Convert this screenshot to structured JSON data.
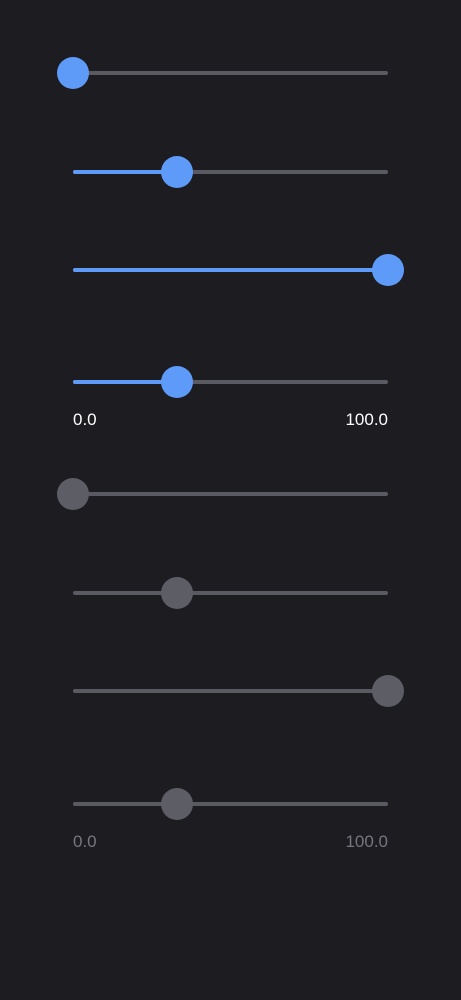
{
  "colors": {
    "background": "#1c1c21",
    "active_fill": "#5e9bf8",
    "active_thumb": "#5e9bf8",
    "inactive_track": "#5a5a62",
    "disabled_thumb": "#5d5d66",
    "label_enabled": "#ffffff",
    "label_disabled": "#76767e"
  },
  "enabled_group": {
    "sliders": [
      {
        "value": 0.0,
        "max": 100.0
      },
      {
        "value": 33.0,
        "max": 100.0
      },
      {
        "value": 100.0,
        "max": 100.0
      },
      {
        "value": 33.0,
        "max": 100.0
      }
    ],
    "labels": {
      "min": "0.0",
      "max": "100.0"
    }
  },
  "disabled_group": {
    "sliders": [
      {
        "value": 0.0,
        "max": 100.0
      },
      {
        "value": 33.0,
        "max": 100.0
      },
      {
        "value": 100.0,
        "max": 100.0
      },
      {
        "value": 33.0,
        "max": 100.0
      }
    ],
    "labels": {
      "min": "0.0",
      "max": "100.0"
    }
  }
}
